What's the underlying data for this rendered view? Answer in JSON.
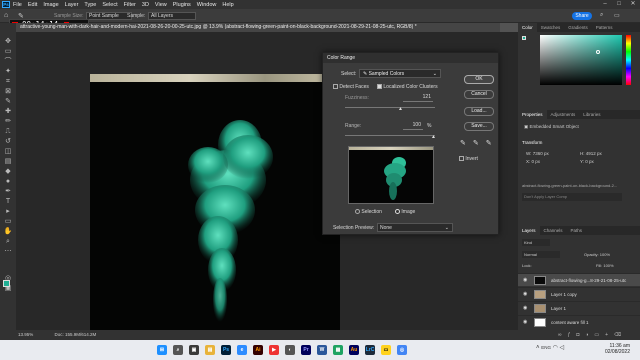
{
  "menubar": {
    "logo": "Ps",
    "items": [
      "File",
      "Edit",
      "Image",
      "Layer",
      "Type",
      "Select",
      "Filter",
      "3D",
      "View",
      "Plugins",
      "Window",
      "Help"
    ]
  },
  "optbar": {
    "sample_size_label": "Sample Size:",
    "sample_size_value": "Point Sample",
    "sample_label": "Sample:",
    "sample_value": "All Layers",
    "share_label": "Share"
  },
  "recorder": {
    "time": "00:14:14"
  },
  "document": {
    "tab_title": "attractive-young-man-with-dark-hair-and-modern-hai-2021-08-26-20-00-25-utc.jpg @ 13.9% (abstract-flowing-green-paint-on-black-background-2021-08-29-21-08-25-utc, RGB/8) *",
    "zoom": "13.95%",
    "doc_info": "Doc: 155.9M/614.2M"
  },
  "color_range": {
    "title": "Color Range",
    "select_label": "Select:",
    "select_value": "Sampled Colors",
    "detect_faces_label": "Detect Faces",
    "localized_label": "Localized Color Clusters",
    "fuzziness_label": "Fuzziness:",
    "fuzziness_value": "121",
    "range_label": "Range:",
    "range_value": "100",
    "range_unit": "%",
    "selection_label": "Selection",
    "image_label": "Image",
    "preview_label": "Selection Preview:",
    "preview_value": "None",
    "ok_label": "OK",
    "cancel_label": "Cancel",
    "load_label": "Load...",
    "save_label": "Save...",
    "invert_label": "Invert"
  },
  "color_panel": {
    "tabs": [
      "Color",
      "Swatches",
      "Gradients",
      "Patterns"
    ],
    "hue_color": "#1ec8b0"
  },
  "properties_panel": {
    "tabs": [
      "Properties",
      "Adjustments",
      "Libraries"
    ],
    "kind": "Embedded Smart Object",
    "transform_label": "Transform",
    "w_label": "W:",
    "w_value": "7360 px",
    "h_label": "H:",
    "h_value": "4912 px",
    "x_label": "X:",
    "x_value": "0 px",
    "y_label": "Y:",
    "y_value": "0 px",
    "filename": "abstract-flowing-green-paint-on-black-background-2...",
    "comp_label": "Don't Apply Layer Comp"
  },
  "layers_panel": {
    "tabs": [
      "Layers",
      "Channels",
      "Paths"
    ],
    "kind_label": "Kind",
    "blend_mode": "Normal",
    "opacity_label": "Opacity:",
    "opacity_value": "100%",
    "lock_label": "Lock:",
    "fill_label": "Fill:",
    "fill_value": "100%",
    "layers": [
      {
        "name": "abstract-flowing-g...8-29-21-08-25-utc"
      },
      {
        "name": "Layer 1 copy"
      },
      {
        "name": "Layer 1"
      },
      {
        "name": "content aware fill 1"
      }
    ]
  },
  "taskbar": {
    "time": "11:36 am",
    "date": "02/08/2022",
    "lang": "ENG"
  }
}
